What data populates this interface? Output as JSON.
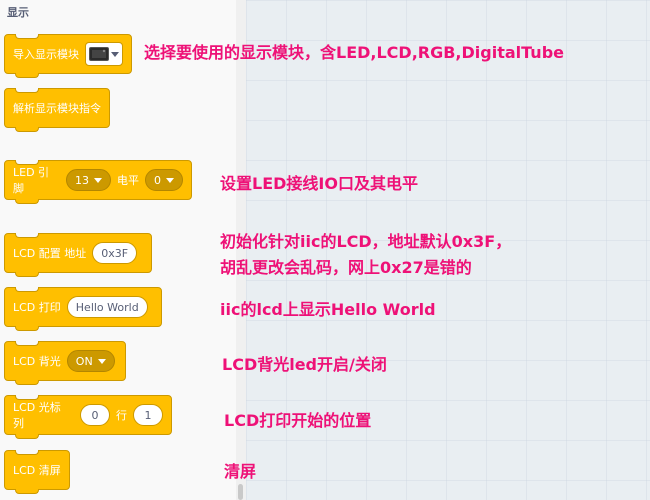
{
  "palette": {
    "category": "显示",
    "blocks": {
      "import_module": {
        "label": "导入显示模块",
        "image_icon": "display-module-icon"
      },
      "parse_commands": {
        "label": "解析显示模块指令"
      },
      "led_pin": {
        "label1": "LED 引脚",
        "pin_value": "13",
        "label2": "电平",
        "level_value": "0"
      },
      "lcd_config": {
        "label": "LCD 配置 地址",
        "address_value": "0x3F"
      },
      "lcd_print": {
        "label": "LCD 打印",
        "text_value": "Hello World"
      },
      "lcd_backlight": {
        "label": "LCD 背光",
        "state_value": "ON"
      },
      "lcd_cursor": {
        "label1": "LCD 光标 列",
        "col_value": "0",
        "label2": "行",
        "row_value": "1"
      },
      "lcd_clear": {
        "label": "LCD 清屏"
      }
    }
  },
  "annotations": {
    "import_module": "选择要使用的显示模块，含LED,LCD,RGB,DigitalTube",
    "led_pin": "设置LED接线IO口及其电平",
    "lcd_config_line1": "初始化针对iic的LCD，地址默认0x3F，",
    "lcd_config_line2": "胡乱更改会乱码，网上0x27是错的",
    "lcd_print": "iic的lcd上显示Hello World",
    "lcd_backlight": "LCD背光led开启/关闭",
    "lcd_cursor": "LCD打印开始的位置",
    "lcd_clear": "清屏"
  },
  "colors": {
    "block": "#ffbf00",
    "block_border": "#cc9900",
    "annotation": "#ee1177",
    "workspace": "#e9eef2"
  }
}
